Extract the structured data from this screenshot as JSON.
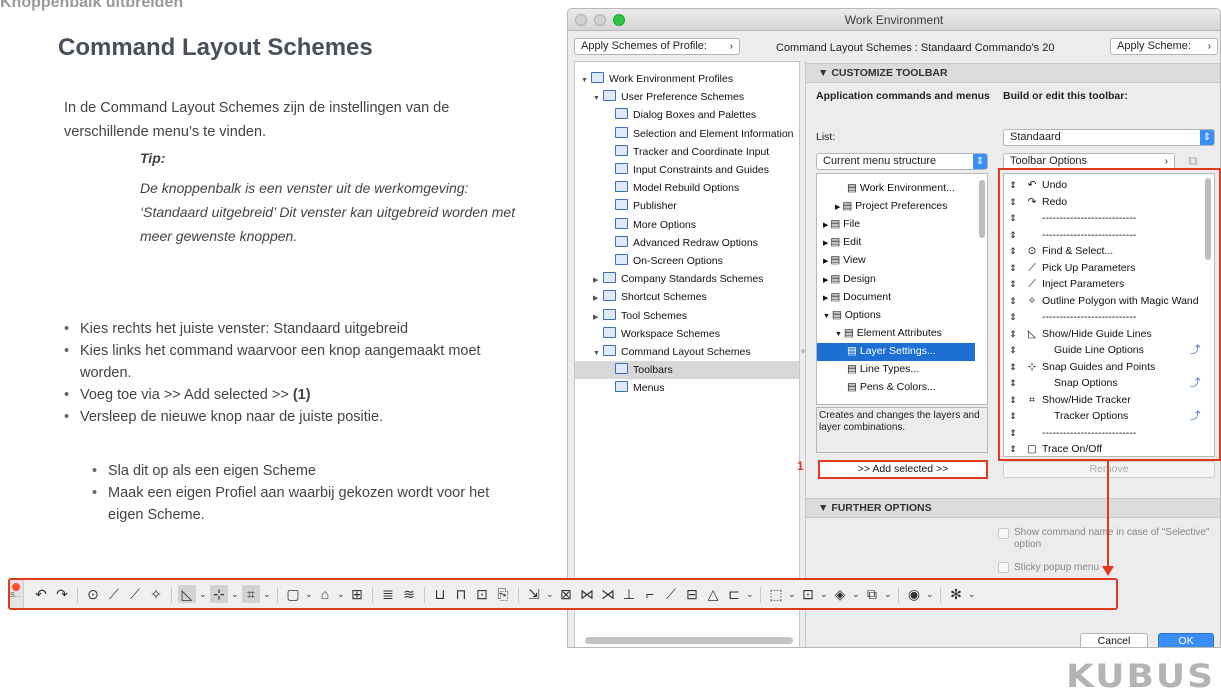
{
  "slide": {
    "title": "Knoppenbalk uitbreiden",
    "heading": "Command Layout Schemes",
    "intro": "In de Command Layout Schemes zijn de instellingen van de verschillende menu’s te vinden.",
    "tip_label": "Tip:",
    "tip_body": "De knoppenbalk is een venster uit de werkomgeving: ‘Standaard uitgebreid’ Dit venster kan uitgebreid worden met meer gewenste knoppen.",
    "bullets": [
      "Kies rechts het juiste venster: Standaard uitgebreid",
      "Kies links het command waarvoor een knop aangemaakt moet worden.",
      "Voeg toe via >> Add selected >>",
      "Versleep de nieuwe knop naar de juiste positie."
    ],
    "bullet3_suffix": "(1)",
    "sub_bullets": [
      "Sla dit op als een eigen Scheme",
      "Maak een eigen Profiel aan waarbij gekozen wordt voor het eigen Scheme."
    ],
    "marker": "1",
    "brand": "KUBUS"
  },
  "window": {
    "title": "Work Environment",
    "apply_profile": "Apply Schemes of Profile:",
    "scheme_caption": "Command Layout Schemes : Standaard Commando's 20",
    "apply_scheme": "Apply Scheme:",
    "tree": [
      {
        "label": "Work Environment Profiles",
        "level": 0,
        "arrow": "▼"
      },
      {
        "label": "User Preference Schemes",
        "level": 1,
        "arrow": "▼"
      },
      {
        "label": "Dialog Boxes and Palettes",
        "level": 2,
        "arrow": ""
      },
      {
        "label": "Selection and Element Information",
        "level": 2,
        "arrow": ""
      },
      {
        "label": "Tracker and Coordinate Input",
        "level": 2,
        "arrow": ""
      },
      {
        "label": "Input Constraints and Guides",
        "level": 2,
        "arrow": ""
      },
      {
        "label": "Model Rebuild Options",
        "level": 2,
        "arrow": ""
      },
      {
        "label": "Publisher",
        "level": 2,
        "arrow": ""
      },
      {
        "label": "More Options",
        "level": 2,
        "arrow": ""
      },
      {
        "label": "Advanced Redraw Options",
        "level": 2,
        "arrow": ""
      },
      {
        "label": "On-Screen Options",
        "level": 2,
        "arrow": ""
      },
      {
        "label": "Company Standards Schemes",
        "level": 1,
        "arrow": "▶"
      },
      {
        "label": "Shortcut Schemes",
        "level": 1,
        "arrow": "▶"
      },
      {
        "label": "Tool Schemes",
        "level": 1,
        "arrow": "▶"
      },
      {
        "label": "Workspace Schemes",
        "level": 1,
        "arrow": ""
      },
      {
        "label": "Command Layout Schemes",
        "level": 1,
        "arrow": "▼"
      },
      {
        "label": "Toolbars",
        "level": 2,
        "arrow": "",
        "selected": true
      },
      {
        "label": "Menus",
        "level": 2,
        "arrow": ""
      }
    ],
    "customize_header": "CUSTOMIZE TOOLBAR",
    "left_col_header": "Application commands and menus",
    "right_col_header": "Build or edit this toolbar:",
    "list_label": "List:",
    "list_select": "Standaard",
    "menu_structure": "Current menu structure",
    "toolbar_options": "Toolbar Options",
    "commands": [
      {
        "label": "Work Environment...",
        "indent": 2,
        "arrow": ""
      },
      {
        "label": "Project Preferences",
        "indent": 1,
        "arrow": "▶"
      },
      {
        "label": "File",
        "indent": 0,
        "arrow": "▶"
      },
      {
        "label": "Edit",
        "indent": 0,
        "arrow": "▶"
      },
      {
        "label": "View",
        "indent": 0,
        "arrow": "▶"
      },
      {
        "label": "Design",
        "indent": 0,
        "arrow": "▶"
      },
      {
        "label": "Document",
        "indent": 0,
        "arrow": "▶"
      },
      {
        "label": "Options",
        "indent": 0,
        "arrow": "▼"
      },
      {
        "label": "Element Attributes",
        "indent": 1,
        "arrow": "▼"
      },
      {
        "label": "Layer Settings...",
        "indent": 2,
        "arrow": "",
        "selected": true
      },
      {
        "label": "Line Types...",
        "indent": 2,
        "arrow": ""
      },
      {
        "label": "Pens & Colors...",
        "indent": 2,
        "arrow": ""
      }
    ],
    "description": "Creates and changes the layers and layer combinations.",
    "toolbar_items": [
      {
        "label": "Undo",
        "icon": "undo-icon"
      },
      {
        "label": "Redo",
        "icon": "redo-icon"
      },
      {
        "label": "---------------------------",
        "icon": ""
      },
      {
        "label": "---------------------------",
        "icon": ""
      },
      {
        "label": "Find & Select...",
        "icon": "find-select-icon"
      },
      {
        "label": "Pick Up Parameters",
        "icon": "pick-up-icon"
      },
      {
        "label": "Inject Parameters",
        "icon": "inject-icon"
      },
      {
        "label": "Outline Polygon with Magic Wand",
        "icon": "magic-wand-icon"
      },
      {
        "label": "---------------------------",
        "icon": ""
      },
      {
        "label": "Show/Hide Guide Lines",
        "icon": "guide-lines-icon"
      },
      {
        "label": "Guide Line Options",
        "icon": "",
        "sub": true
      },
      {
        "label": "Snap Guides and Points",
        "icon": "snap-icon"
      },
      {
        "label": "Snap Options",
        "icon": "",
        "sub": true
      },
      {
        "label": "Show/Hide Tracker",
        "icon": "tracker-icon"
      },
      {
        "label": "Tracker Options",
        "icon": "",
        "sub": true
      },
      {
        "label": "---------------------------",
        "icon": ""
      },
      {
        "label": "Trace On/Off",
        "icon": "trace-icon"
      }
    ],
    "add_selected": ">> Add selected >>",
    "remove": "Remove",
    "further_options": "FURTHER OPTIONS",
    "show_command_name": "Show command name in case of \"Selective\" option",
    "sticky_popup": "Sticky popup menu",
    "cancel": "Cancel",
    "ok": "OK"
  },
  "toolbar": {
    "grip_label": "S..."
  }
}
